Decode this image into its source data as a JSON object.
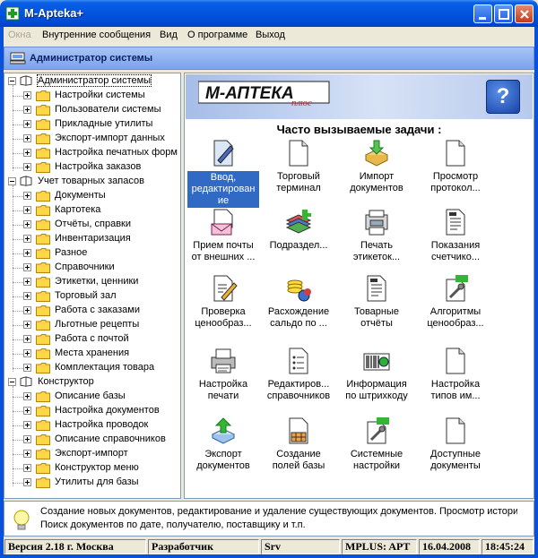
{
  "window": {
    "title": "M-Apteka+"
  },
  "menu": {
    "items": [
      "Окна",
      "Внутренние сообщения",
      "Вид",
      "О программе",
      "Выход"
    ]
  },
  "header": {
    "title": "Администратор системы"
  },
  "tree": {
    "root": "Администратор системы",
    "groups": [
      {
        "label": "Администратор системы",
        "items": [
          "Настройки системы",
          "Пользователи системы",
          "Прикладные утилиты",
          "Экспорт-импорт данных",
          "Настройка печатных форм",
          "Настройка заказов"
        ]
      },
      {
        "label": "Учет товарных запасов",
        "items": [
          "Документы",
          "Картотека",
          "Отчёты, справки",
          "Инвентаризация",
          "Разное",
          "Справочники",
          "Этикетки, ценники",
          "Торговый зал",
          "Работа с заказами",
          "Льготные рецепты",
          "Работа с почтой",
          "Места хранения",
          "Комплектация товара"
        ]
      },
      {
        "label": "Конструктор",
        "items": [
          "Описание базы",
          "Настройка документов",
          "Настройка проводок",
          "Описание справочников",
          "Экспорт-импорт",
          "Конструктор меню",
          "Утилиты для базы"
        ]
      }
    ]
  },
  "banner": {
    "logo_text": "М-АПТЕКА",
    "logo_sub": "плюс",
    "help_label": "?"
  },
  "tasks": {
    "title": "Часто вызываемые задачи :",
    "items": [
      {
        "line1": "Ввод,",
        "line2": "редактирован",
        "line3": "ие",
        "icon": "edit-document-icon"
      },
      {
        "line1": "Торговый",
        "line2": "терминал",
        "icon": "document-icon"
      },
      {
        "line1": "Импорт",
        "line2": "документов",
        "icon": "import-icon"
      },
      {
        "line1": "Просмотр",
        "line2": "протокол...",
        "icon": "document-icon"
      },
      {
        "line1": "Прием почты",
        "line2": "от внешних ...",
        "icon": "mail-icon"
      },
      {
        "line1": "Подраздел...",
        "line2": "",
        "icon": "books-icon"
      },
      {
        "line1": "Печать",
        "line2": "этикеток...",
        "icon": "label-printer-icon"
      },
      {
        "line1": "Показания",
        "line2": "счетчико...",
        "icon": "report-icon"
      },
      {
        "line1": "Проверка",
        "line2": "ценообраз...",
        "icon": "pencil-document-icon"
      },
      {
        "line1": "Расхождение",
        "line2": "сальдо по ...",
        "icon": "coins-icon"
      },
      {
        "line1": "Товарные",
        "line2": "отчёты",
        "icon": "report-icon"
      },
      {
        "line1": "Алгоритмы",
        "line2": "ценообраз...",
        "icon": "settings-document-icon"
      },
      {
        "line1": "Настройка",
        "line2": "печати",
        "icon": "printer-icon"
      },
      {
        "line1": "Редактиров...",
        "line2": "справочников",
        "icon": "list-icon"
      },
      {
        "line1": "Информация",
        "line2": "по штрихкоду",
        "icon": "barcode-icon"
      },
      {
        "line1": "Настройка",
        "line2": "типов им...",
        "icon": "document-icon"
      },
      {
        "line1": "Экспорт",
        "line2": "документов",
        "icon": "export-icon"
      },
      {
        "line1": "Создание",
        "line2": "полей базы",
        "icon": "table-document-icon"
      },
      {
        "line1": "Системные",
        "line2": "настройки",
        "icon": "settings-document-icon"
      },
      {
        "line1": "Доступные",
        "line2": "документы",
        "icon": "document-icon"
      }
    ]
  },
  "hint": {
    "line1": "Создание новых документов, редактирование и удаление существующих документов. Просмотр истори",
    "line2": "Поиск документов по дате, получателю, поставщику и т.п."
  },
  "status": {
    "version": "Версия 2.18 г. Москва",
    "developer": "Разработчик",
    "server": "Srv",
    "db": "MPLUS: APT",
    "date": "16.04.2008",
    "time": "18:45:24"
  },
  "colors": {
    "title_bar": "#0254de",
    "selection": "#316ac5",
    "header_band": "#7aa2ec",
    "logo_red": "#d0201f"
  }
}
